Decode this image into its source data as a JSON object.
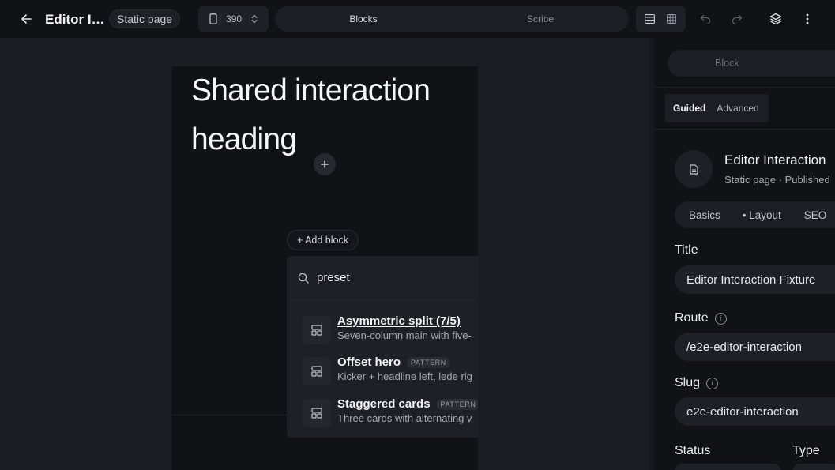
{
  "topbar": {
    "title": "Editor I…",
    "page_type": "Static page",
    "viewport_width": "390",
    "mode_tabs": [
      {
        "label": "Blocks",
        "active": true
      },
      {
        "label": "Scribe",
        "active": false
      }
    ]
  },
  "canvas": {
    "heading": "Shared interaction heading",
    "add_block_label": "+ Add block",
    "picker": {
      "search_value": "preset",
      "results": [
        {
          "name": "Asymmetric split (7/5)",
          "badge": "",
          "description": "Seven-column main with five-"
        },
        {
          "name": "Offset hero",
          "badge": "PATTERN",
          "description": "Kicker + headline left, lede rig"
        },
        {
          "name": "Staggered cards",
          "badge": "PATTERN",
          "description": "Three cards with alternating v"
        }
      ]
    }
  },
  "panel": {
    "block_tab": "Block",
    "modes": [
      {
        "label": "Guided",
        "active": true
      },
      {
        "label": "Advanced",
        "active": false
      }
    ],
    "card": {
      "title": "Editor Interaction",
      "subtitle": "Static page · Published"
    },
    "subtabs": [
      "Basics",
      "• Layout",
      "SEO"
    ],
    "fields": {
      "title_label": "Title",
      "title_value": "Editor Interaction Fixture",
      "route_label": "Route",
      "route_value": "/e2e-editor-interaction",
      "slug_label": "Slug",
      "slug_value": "e2e-editor-interaction",
      "status_label": "Status",
      "type_label": "Type"
    }
  },
  "colors": {
    "background": "#1b1d24",
    "bar": "#111216",
    "surface": "#1e2027",
    "text": "#e6e7ea"
  }
}
